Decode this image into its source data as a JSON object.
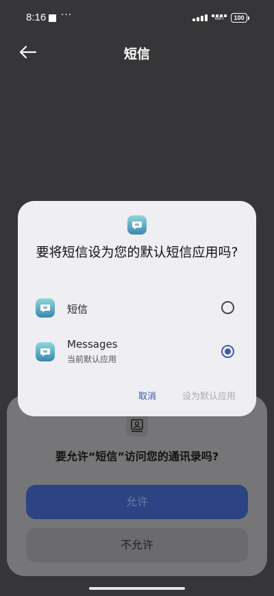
{
  "status_bar": {
    "time": "8:16",
    "dots": "···",
    "wifi_label": "WIFI",
    "battery": "100"
  },
  "header": {
    "title": "短信"
  },
  "dialog": {
    "title": "要将短信设为您的默认短信应用吗?",
    "options": [
      {
        "label": "短信",
        "sublabel": "",
        "selected": false
      },
      {
        "label": "Messages",
        "sublabel": "当前默认应用",
        "selected": true
      }
    ],
    "cancel_label": "取消",
    "set_default_label": "设为默认应用"
  },
  "permission_sheet": {
    "question": "要允许“短信”访问您的通讯录吗?",
    "allow_label": "允许",
    "deny_label": "不允许"
  },
  "colors": {
    "accent": "#3f5aa6",
    "icon_gradient_top": "#84d1d9",
    "icon_gradient_bottom": "#3f8bb5"
  },
  "icons": {
    "back": "arrow-left-icon",
    "app": "chat-bubble-icon",
    "contact": "contact-card-icon"
  }
}
